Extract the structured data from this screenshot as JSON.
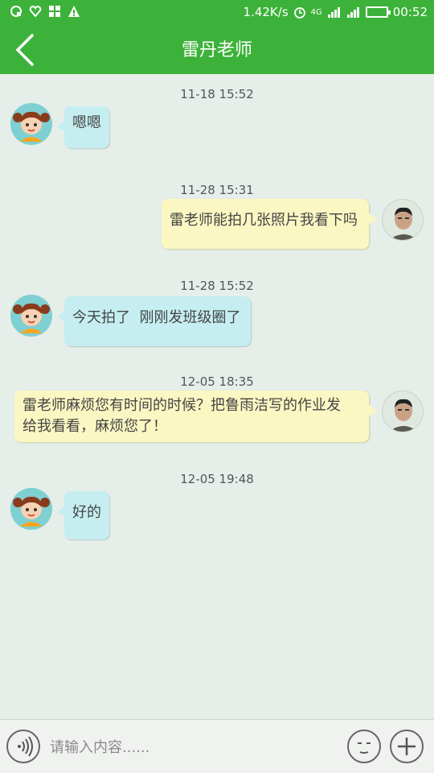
{
  "status_bar": {
    "speed": "1.42K/s",
    "network": "4G",
    "time": "00:52",
    "icons": [
      "notification-icon",
      "heart-icon",
      "apps-icon",
      "warning-icon",
      "alarm-icon",
      "signal-icon",
      "wifi-signal-icon",
      "battery-icon"
    ]
  },
  "header": {
    "title": "雷丹老师",
    "back_icon": "chevron-left-icon"
  },
  "messages": [
    {
      "timestamp": "11-18 15:52",
      "from": "teacher",
      "text": "嗯嗯"
    },
    {
      "timestamp": "11-28 15:31",
      "from": "me",
      "text": "雷老师能拍几张照片我看下吗"
    },
    {
      "timestamp": "11-28 15:52",
      "from": "teacher",
      "text": "今天拍了  刚刚发班级圈了"
    },
    {
      "timestamp": "12-05 18:35",
      "from": "me",
      "text_line1": "雷老师麻烦您有时间的时候？把鲁雨洁写的作业发",
      "text_line2": "给我看看，麻烦您了！"
    },
    {
      "timestamp": "12-05 19:48",
      "from": "teacher",
      "text": "好的"
    }
  ],
  "input_bar": {
    "placeholder": "请输入内容......",
    "value": ""
  },
  "colors": {
    "brand_green": "#3db23a",
    "chat_background": "#e6eeea",
    "received_bubble": "#c6eef0",
    "sent_bubble": "#fbf7c3"
  }
}
